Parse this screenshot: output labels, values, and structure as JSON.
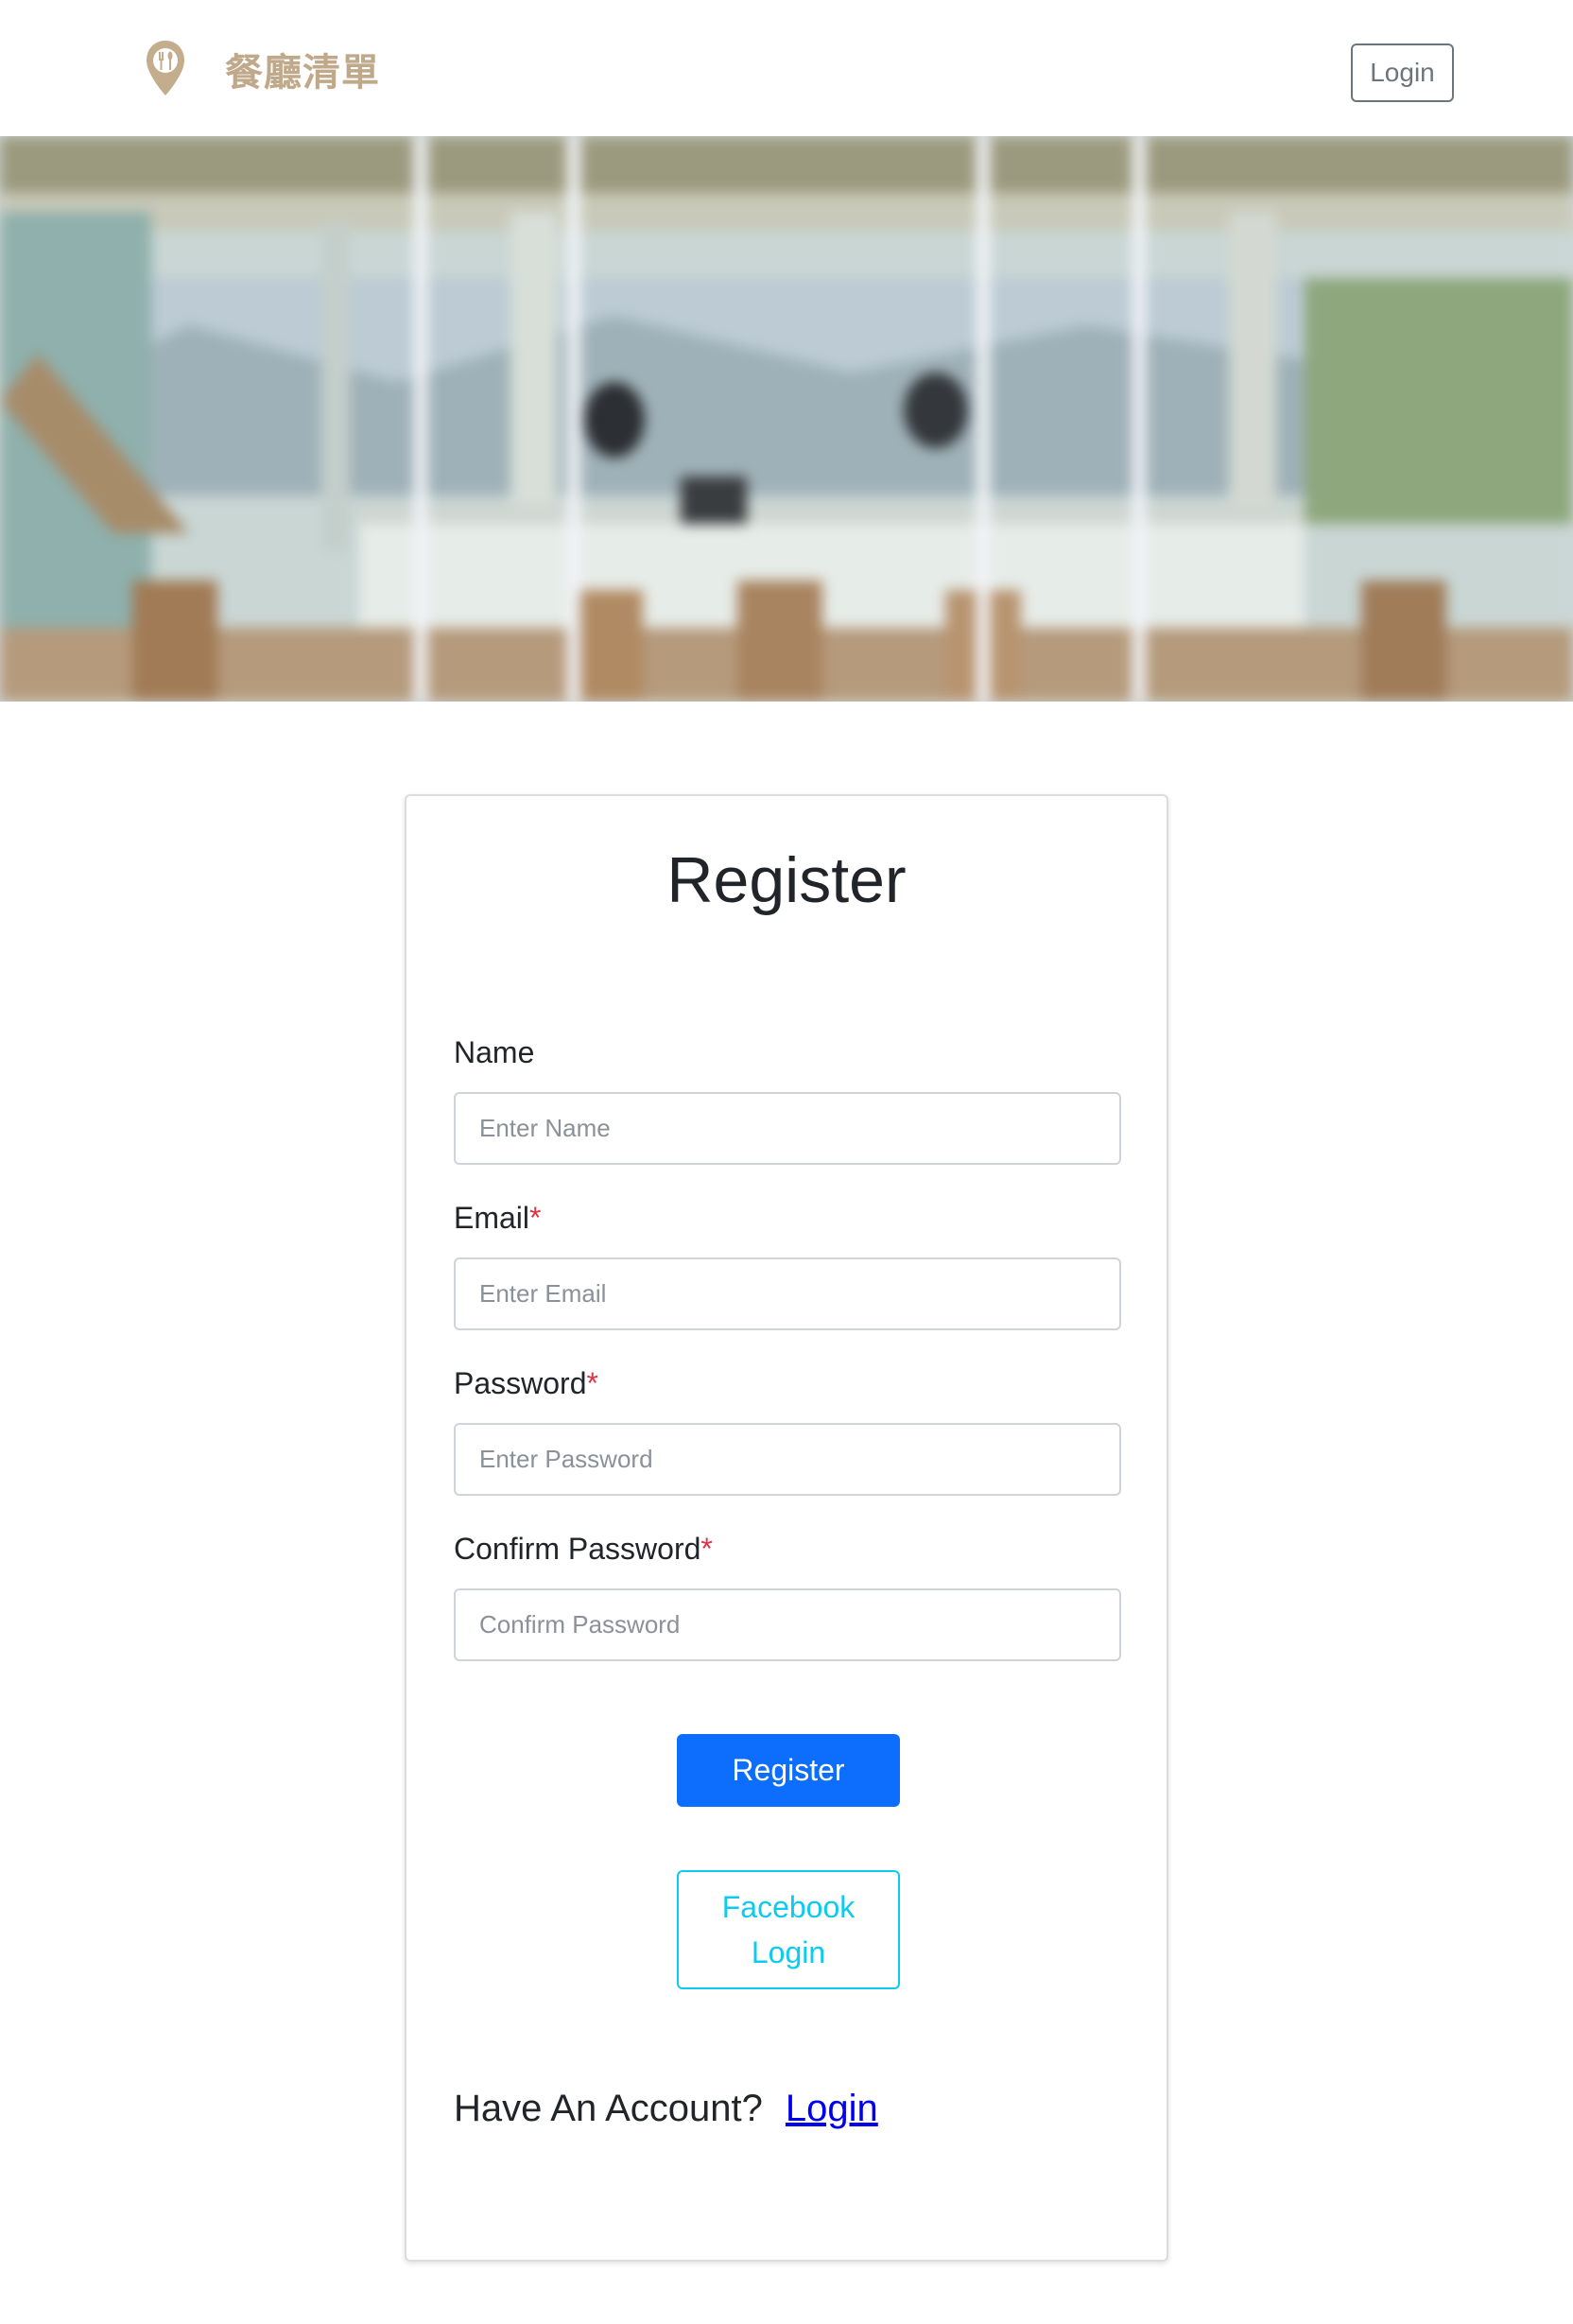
{
  "navbar": {
    "brand_name": "餐廳清單",
    "brand_icon": "map-pin-utensils-icon",
    "login_label": "Login"
  },
  "hero": {
    "image": "blurred-restaurant-interior-photo"
  },
  "register": {
    "title": "Register",
    "fields": {
      "name": {
        "label": "Name",
        "required": false,
        "placeholder": "Enter Name"
      },
      "email": {
        "label": "Email",
        "required": true,
        "placeholder": "Enter Email"
      },
      "password": {
        "label": "Password",
        "required": true,
        "placeholder": "Enter Password"
      },
      "confirm_password": {
        "label": "Confirm Password",
        "required": true,
        "placeholder": "Confirm Password"
      }
    },
    "required_mark": "*",
    "submit_label": "Register",
    "facebook_label": "Facebook Login",
    "have_account_text": "Have An Account?",
    "login_link": "Login"
  },
  "colors": {
    "brand": "#bfa98a",
    "primary": "#0d6efd",
    "info": "#0dcaf0",
    "required": "#dc3545",
    "link": "#0000ee"
  }
}
